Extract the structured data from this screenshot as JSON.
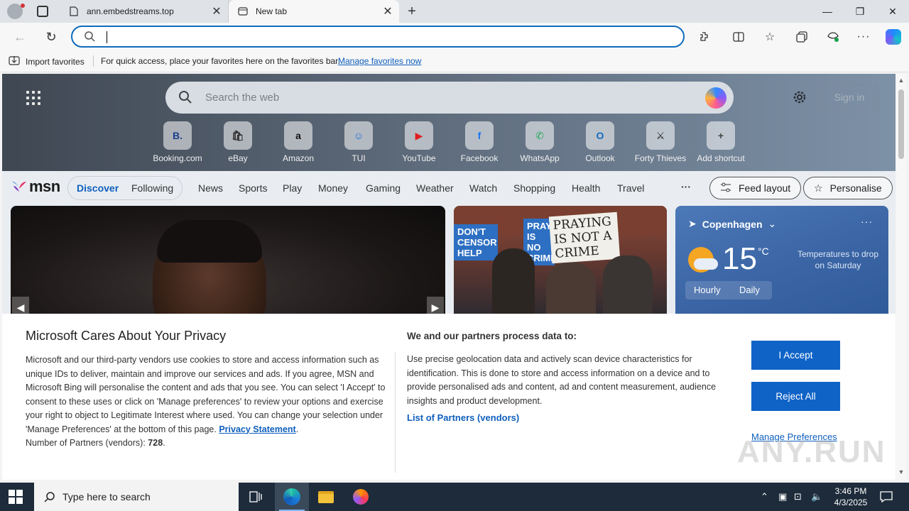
{
  "browser": {
    "tabs": [
      {
        "label": "ann.embedstreams.top",
        "active": false
      },
      {
        "label": "New tab",
        "active": true
      }
    ],
    "address_value": "",
    "favorites_bar": {
      "import_label": "Import favorites",
      "message": "For quick access, place your favorites here on the favorites bar.",
      "link": "Manage favorites now"
    }
  },
  "newtab": {
    "search_placeholder": "Search the web",
    "signin_label": "Sign in",
    "shortcuts": [
      {
        "label": "Booking.com",
        "glyph": "B.",
        "color": "#1a3e8c"
      },
      {
        "label": "eBay",
        "glyph": "🛍",
        "color": "#333333"
      },
      {
        "label": "Amazon",
        "glyph": "a",
        "color": "#111111"
      },
      {
        "label": "TUI",
        "glyph": "☺",
        "color": "#1e6fd9"
      },
      {
        "label": "YouTube",
        "glyph": "▶",
        "color": "#e02020"
      },
      {
        "label": "Facebook",
        "glyph": "f",
        "color": "#1877f2"
      },
      {
        "label": "WhatsApp",
        "glyph": "✆",
        "color": "#1fa855"
      },
      {
        "label": "Outlook",
        "glyph": "O",
        "color": "#0f6cbd"
      },
      {
        "label": "Forty Thieves",
        "glyph": "⚔",
        "color": "#222222"
      },
      {
        "label": "Add shortcut",
        "glyph": "+",
        "color": "#444444"
      }
    ],
    "msn_word": "msn",
    "nav": {
      "discover": "Discover",
      "following": "Following",
      "items": [
        "News",
        "Sports",
        "Play",
        "Money",
        "Gaming",
        "Weather",
        "Watch",
        "Shopping",
        "Health",
        "Travel"
      ],
      "more": "···",
      "feed_layout": "Feed layout",
      "personalise": "Personalise"
    },
    "card2_signs": [
      "DON'T CENSOR HELP",
      "PRAY IS NO CRIME",
      "PRAYING IS NOT A CRIME"
    ],
    "weather": {
      "location": "Copenhagen",
      "temp": "15",
      "unit": "°C",
      "note": "Temperatures to drop on Saturday",
      "tab_hourly": "Hourly",
      "tab_daily": "Daily"
    }
  },
  "privacy": {
    "title": "Microsoft Cares About Your Privacy",
    "body_text": "Microsoft and our third-party vendors use cookies to store and access information such as unique IDs to deliver, maintain and improve our services and ads. If you agree, MSN and Microsoft Bing will personalise the content and ads that you see. You can select 'I Accept' to consent to these uses or click on 'Manage preferences' to review your options and exercise your right to object to Legitimate Interest where used.  You can change your selection under 'Manage Preferences' at the bottom of this page.",
    "privacy_link": "Privacy Statement",
    "partners_label": "Number of Partners (vendors):",
    "partners_count": "728",
    "process_title": "We and our partners process data to:",
    "process_text": "Use precise geolocation data and actively scan device characteristics for identification. This is done to store and access information on a device and to provide personalised ads and content, ad and content measurement, audience insights and product development.",
    "partners_link": "List of Partners (vendors)",
    "accept": "I Accept",
    "reject": "Reject All",
    "manage": "Manage Preferences",
    "watermark": "ANY.RUN"
  },
  "taskbar": {
    "search_placeholder": "Type here to search",
    "time": "3:46 PM",
    "date": "4/3/2025"
  }
}
